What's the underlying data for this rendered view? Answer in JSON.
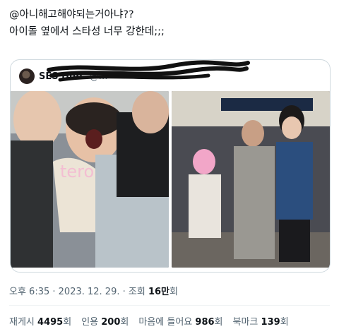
{
  "tweet": {
    "line1": "@아니해고해야되는거아냐??",
    "line2": "아이돌 옆에서 스타성 너무 강한데;;;"
  },
  "quote": {
    "name": "SES Hub",
    "handle": "@…",
    "watermark": "tero"
  },
  "meta": {
    "time": "오후 6:35",
    "date": "2023. 12. 29.",
    "views_label": "조회",
    "views_value": "16만",
    "views_unit": "회"
  },
  "stats": {
    "retweets_label": "재게시",
    "retweets_value": "4495",
    "quotes_label": "인용",
    "quotes_value": "200",
    "likes_label": "마음에 들어요",
    "likes_value": "986",
    "bookmarks_label": "북마크",
    "bookmarks_value": "139",
    "unit": "회"
  },
  "colors": {
    "text": "#0f1419",
    "muted": "#536471",
    "border": "#cfd9de"
  }
}
